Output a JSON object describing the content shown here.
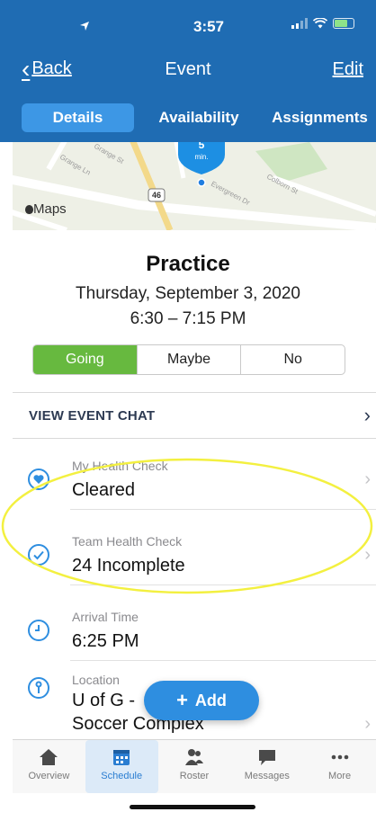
{
  "status_bar": {
    "time": "3:57"
  },
  "nav": {
    "back_label": "Back",
    "title": "Event",
    "edit_label": "Edit"
  },
  "tabs": [
    {
      "label": "Details",
      "active": true
    },
    {
      "label": "Availability",
      "active": false
    },
    {
      "label": "Assignments",
      "active": false
    }
  ],
  "map": {
    "provider_label": "Maps",
    "pin_number": "5",
    "pin_unit": "min.",
    "route_label": "46",
    "streets": [
      "Grange St",
      "Evergreen Dr",
      "Colborn St",
      "Grange Ln"
    ]
  },
  "event": {
    "title": "Practice",
    "date": "Thursday, September 3, 2020",
    "time": "6:30 – 7:15 PM"
  },
  "rsvp": {
    "options": [
      "Going",
      "Maybe",
      "No"
    ],
    "selected": "Going"
  },
  "chat": {
    "label": "VIEW EVENT CHAT"
  },
  "details": [
    {
      "sublabel": "My Health Check",
      "value": "Cleared",
      "icon": "heart-icon"
    },
    {
      "sublabel": "Team Health Check",
      "value": "24 Incomplete",
      "icon": "check-circle-icon"
    },
    {
      "sublabel": "Arrival Time",
      "value": "6:25 PM",
      "icon": "clock-icon"
    },
    {
      "sublabel": "Location",
      "value": "U of G - ",
      "value2": "Soccer Complex",
      "icon": "info-pin-icon"
    }
  ],
  "fab": {
    "label": "Add"
  },
  "bottom_tabs": [
    {
      "label": "Overview",
      "icon": "home-icon",
      "active": false
    },
    {
      "label": "Schedule",
      "icon": "calendar-icon",
      "active": true
    },
    {
      "label": "Roster",
      "icon": "people-icon",
      "active": false
    },
    {
      "label": "Messages",
      "icon": "chat-bubble-icon",
      "active": false
    },
    {
      "label": "More",
      "icon": "more-dots-icon",
      "active": false
    }
  ],
  "colors": {
    "header": "#1f6cb3",
    "tab_active": "#3d97e5",
    "going": "#67b93f",
    "accent": "#2e8ee0",
    "annotation": "#f3f040"
  }
}
